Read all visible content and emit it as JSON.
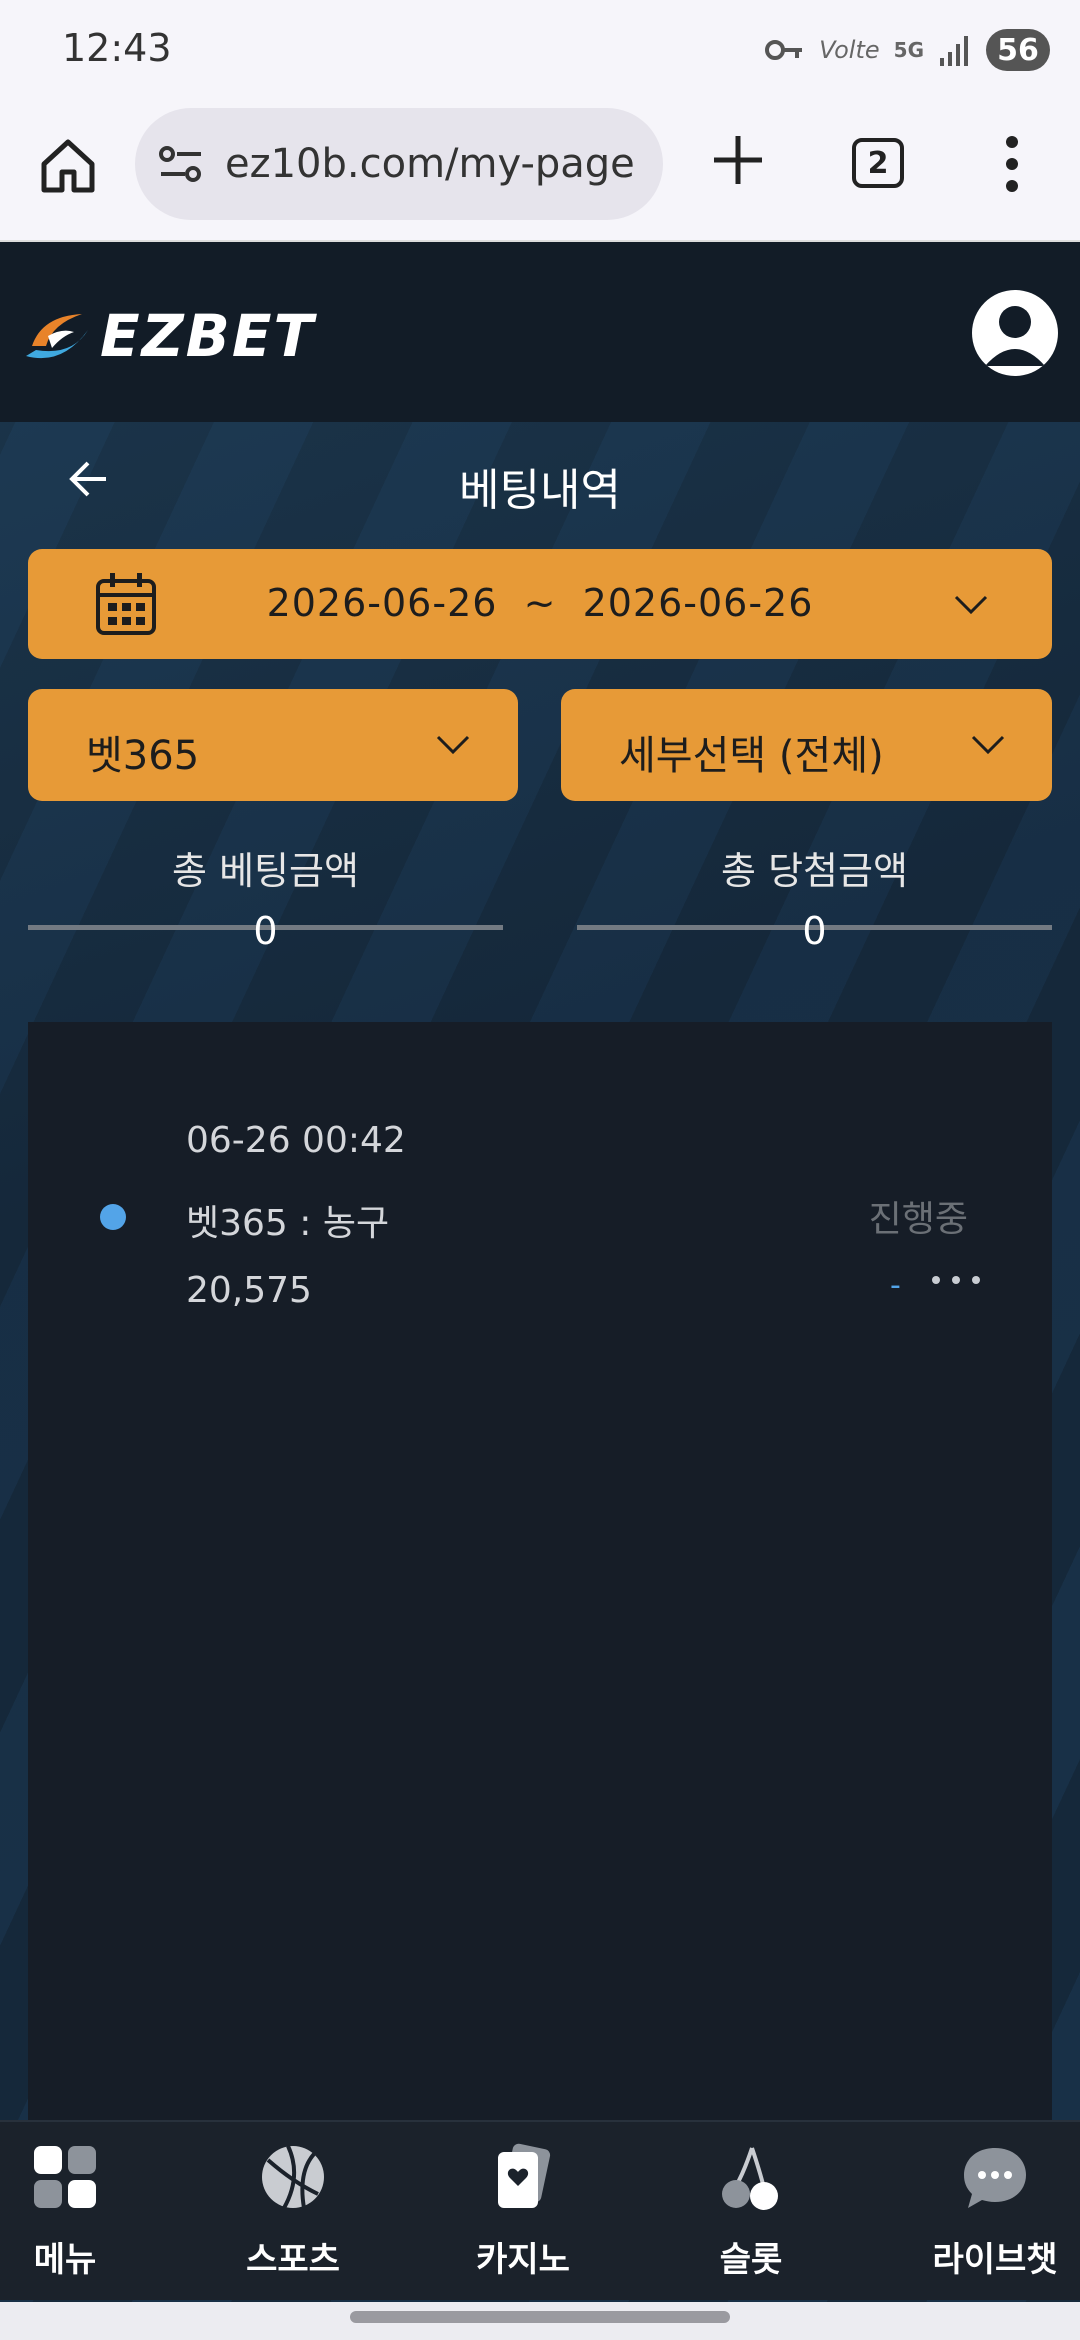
{
  "status_bar": {
    "time": "12:43",
    "network_text": "Volte",
    "network_5g": "5G",
    "battery": "56"
  },
  "browser": {
    "url": "ez10b.com/my-page",
    "tab_count": "2"
  },
  "app": {
    "logo_text": "EZBET",
    "page_title": "베팅내역",
    "date_range": "2026-06-26  ~  2026-06-26",
    "provider_select": "벳365",
    "detail_select": "세부선택 (전체)",
    "summary": {
      "total_bet_label": "총 베팅금액",
      "total_bet_value": "0",
      "total_win_label": "총 당첨금액",
      "total_win_value": "0"
    },
    "bets": [
      {
        "datetime": "06-26 00:42",
        "title": "벳365 : 농구",
        "amount": "20,575",
        "status": "진행중",
        "result": "-"
      }
    ],
    "nav": [
      {
        "label": "메뉴",
        "icon": "menu-grid-icon"
      },
      {
        "label": "스포츠",
        "icon": "basketball-icon"
      },
      {
        "label": "카지노",
        "icon": "cards-icon"
      },
      {
        "label": "슬롯",
        "icon": "cherry-icon"
      },
      {
        "label": "라이브챗",
        "icon": "chat-bubble-icon"
      }
    ]
  },
  "colors": {
    "accent_orange": "#e79a37",
    "status_dot": "#53a4e8",
    "panel": "#161d27",
    "header": "#121c27"
  }
}
